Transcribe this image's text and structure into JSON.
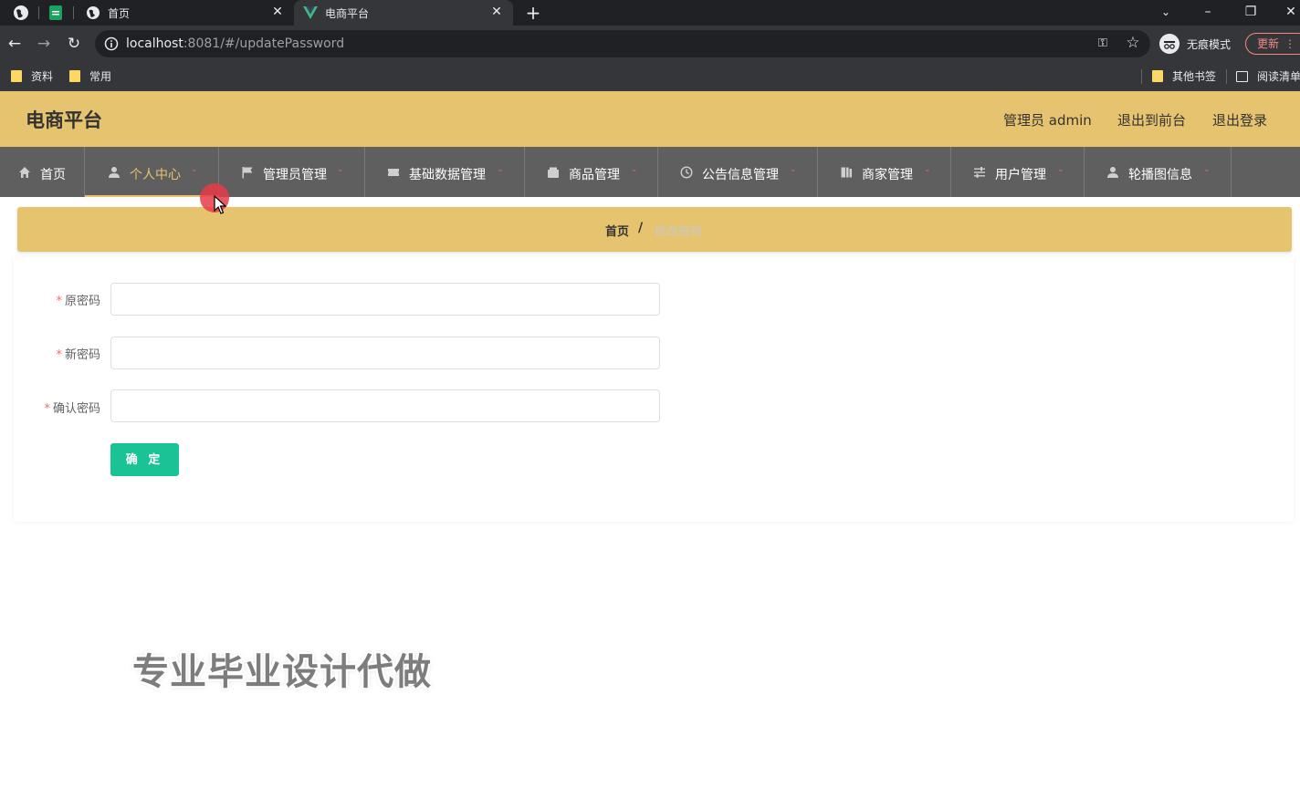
{
  "browser": {
    "tabs": [
      {
        "title": "首页",
        "active": false
      },
      {
        "title": "电商平台",
        "active": true
      }
    ],
    "url_host": "localhost",
    "url_rest": ":8081/#/updatePassword",
    "incognito_label": "无痕模式",
    "update_label": "更新",
    "bookmarks": [
      {
        "label": "资料"
      },
      {
        "label": "常用"
      }
    ],
    "other_bookmarks": "其他书签",
    "reading_list": "阅读清单"
  },
  "header": {
    "brand": "电商平台",
    "user_label": "管理员 admin",
    "to_frontend": "退出到前台",
    "logout": "退出登录"
  },
  "nav": {
    "items": [
      {
        "label": "首页",
        "icon": "home-icon"
      },
      {
        "label": "个人中心",
        "icon": "user-icon"
      },
      {
        "label": "管理员管理",
        "icon": "flag-icon"
      },
      {
        "label": "基础数据管理",
        "icon": "ticket-icon"
      },
      {
        "label": "商品管理",
        "icon": "wallet-icon"
      },
      {
        "label": "公告信息管理",
        "icon": "clock-icon"
      },
      {
        "label": "商家管理",
        "icon": "book-icon"
      },
      {
        "label": "用户管理",
        "icon": "sliders-icon"
      },
      {
        "label": "轮播图信息",
        "icon": "person-icon"
      }
    ],
    "active_index": 1
  },
  "breadcrumb": {
    "home": "首页",
    "separator": "/",
    "current": "修改密码"
  },
  "form": {
    "fields": [
      {
        "label": "原密码",
        "required": true,
        "value": ""
      },
      {
        "label": "新密码",
        "required": true,
        "value": ""
      },
      {
        "label": "确认密码",
        "required": true,
        "value": ""
      }
    ],
    "submit_label": "确 定"
  },
  "overlay": {
    "watermark": "专业毕业设计代做"
  },
  "colors": {
    "accent": "#e6c36e",
    "nav_bg": "#5f5f5f",
    "submit": "#19c396",
    "required": "#f56c6c"
  }
}
